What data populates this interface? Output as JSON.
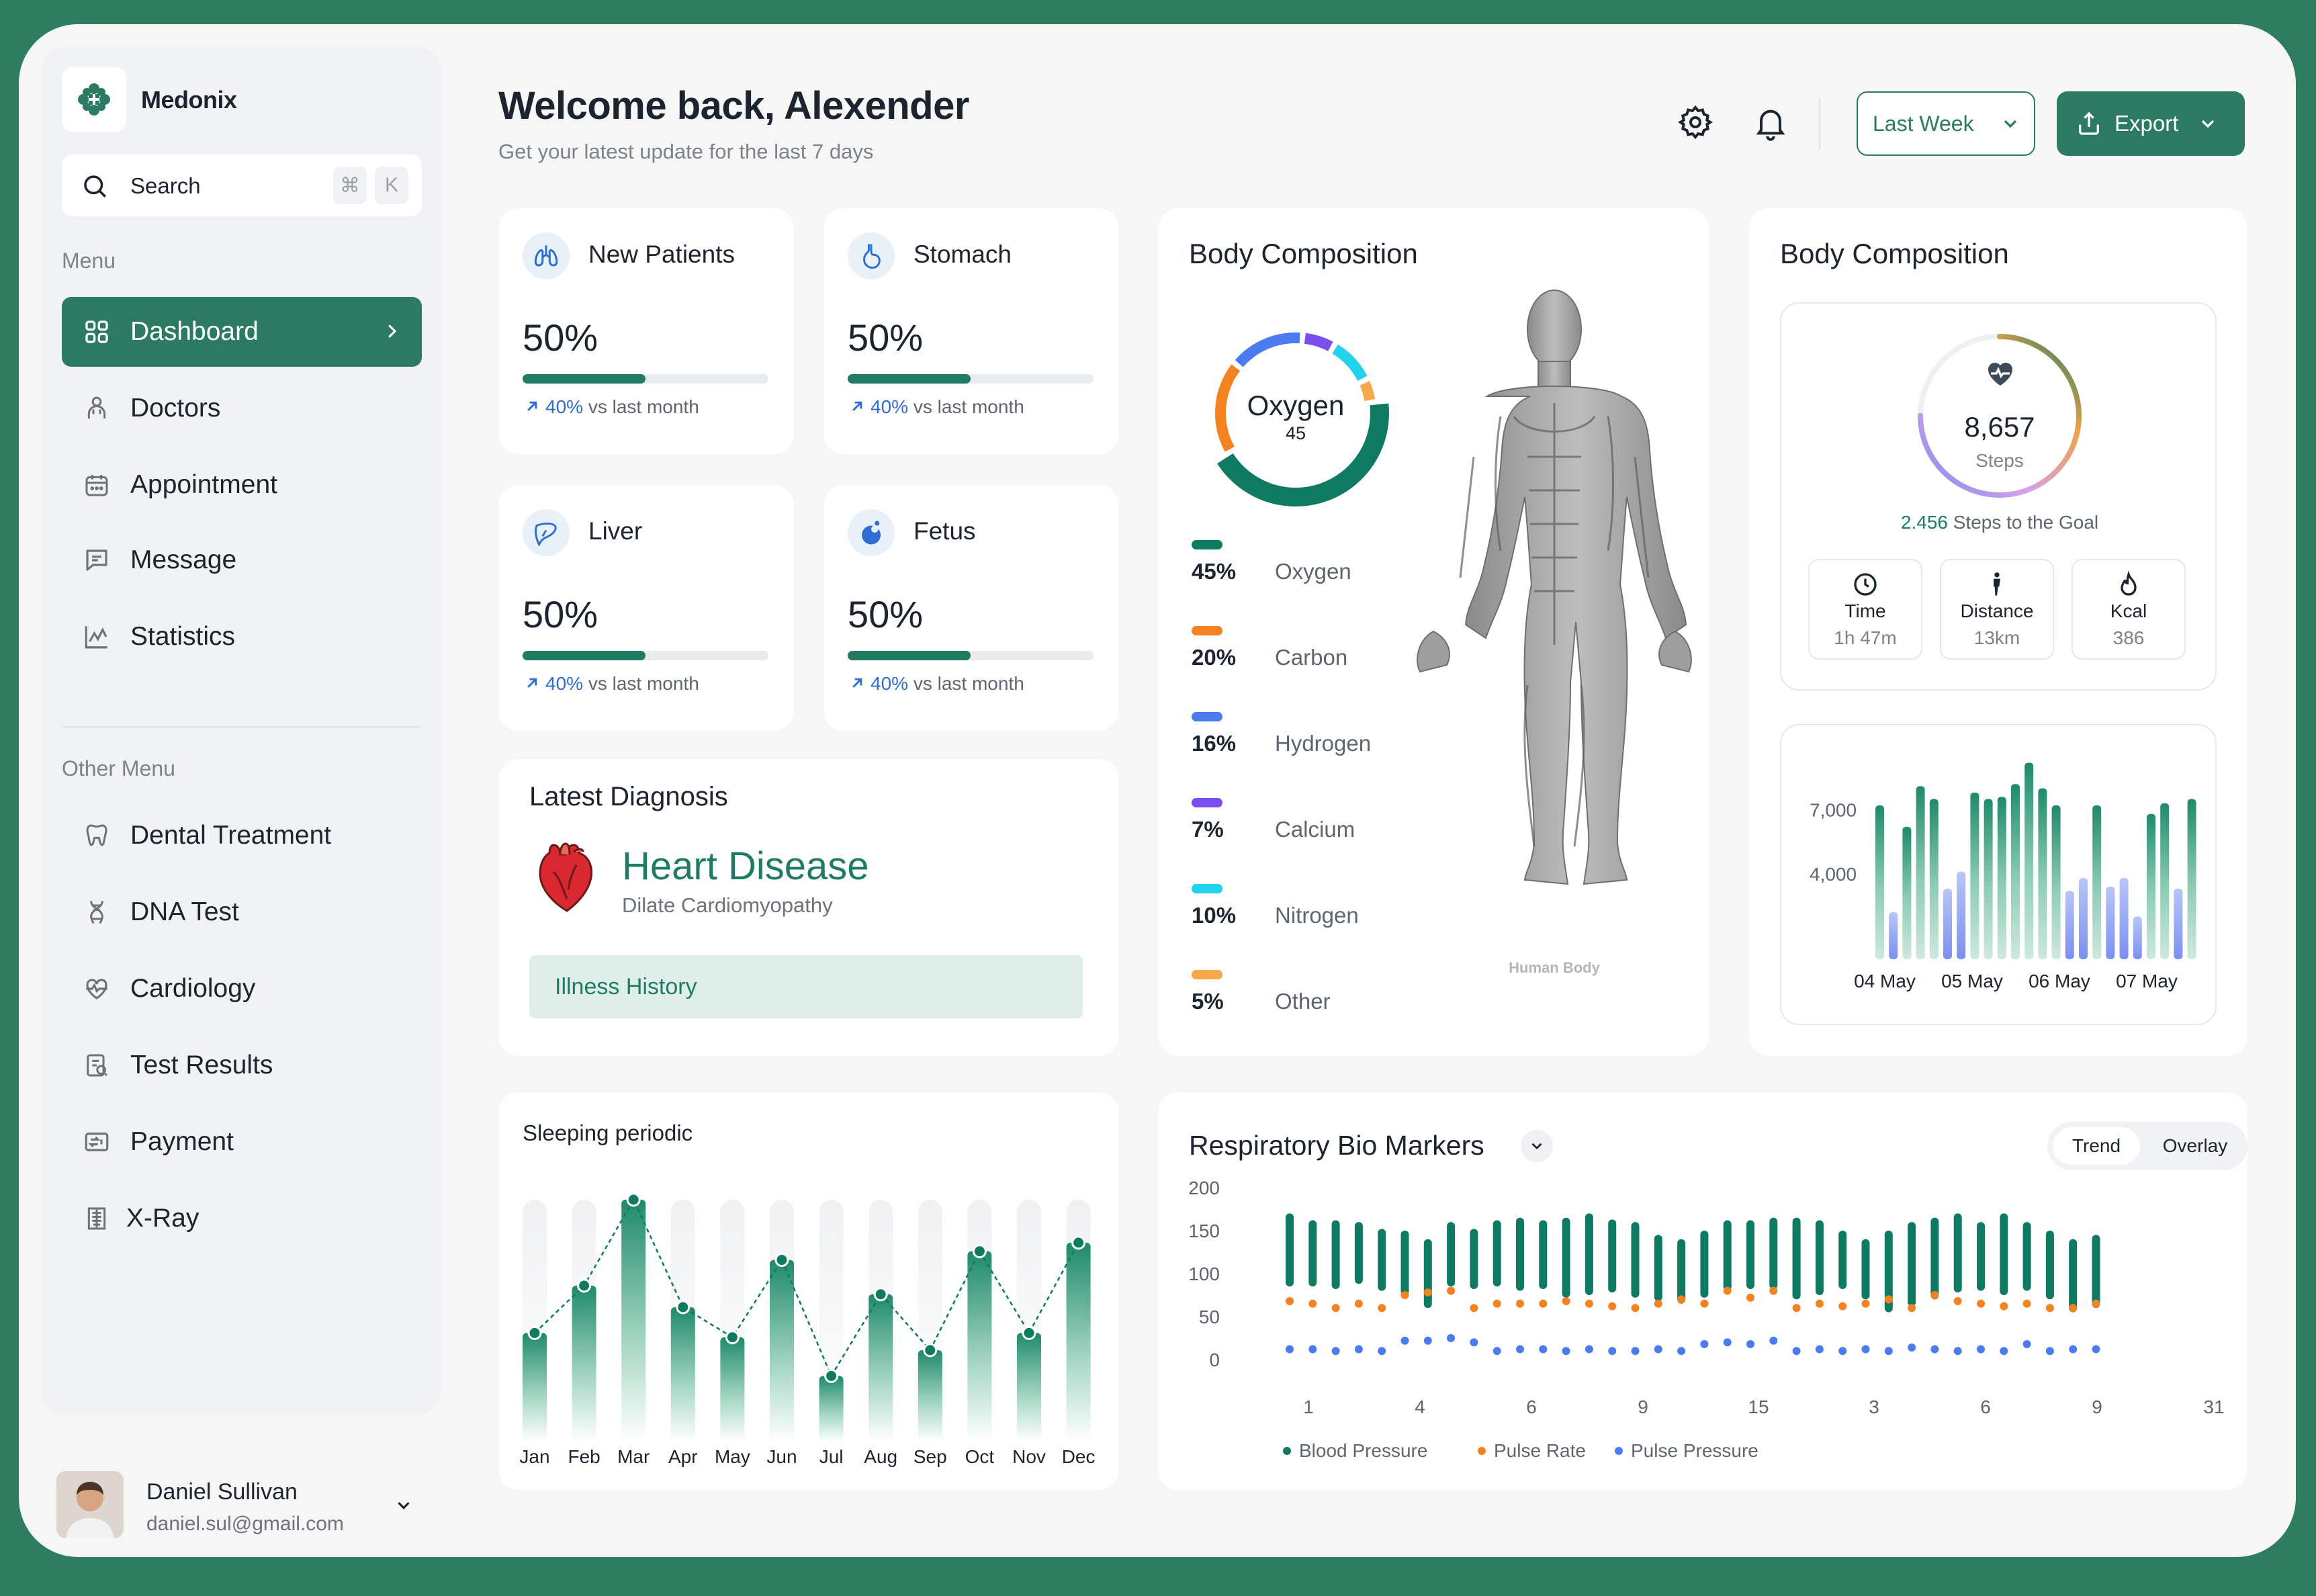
{
  "app": {
    "name": "Medonix"
  },
  "search": {
    "label": "Search",
    "shortcut_cmd": "⌘",
    "shortcut_key": "K"
  },
  "sidebar": {
    "menu_title": "Menu",
    "items": [
      {
        "label": "Dashboard",
        "icon": "grid-icon",
        "active": true
      },
      {
        "label": "Doctors",
        "icon": "doctor-icon"
      },
      {
        "label": "Appointment",
        "icon": "calendar-icon"
      },
      {
        "label": "Message",
        "icon": "message-icon"
      },
      {
        "label": "Statistics",
        "icon": "chart-line-icon"
      }
    ],
    "other_title": "Other Menu",
    "other_items": [
      {
        "label": "Dental Treatment",
        "icon": "tooth-icon"
      },
      {
        "label": "DNA Test",
        "icon": "dna-icon"
      },
      {
        "label": "Cardiology",
        "icon": "heart-pulse-icon"
      },
      {
        "label": "Test Results",
        "icon": "clipboard-icon"
      },
      {
        "label": "Payment",
        "icon": "payment-icon"
      },
      {
        "label": "X-Ray",
        "icon": "xray-icon"
      }
    ]
  },
  "user": {
    "name": "Daniel Sullivan",
    "email": "daniel.sul@gmail.com"
  },
  "header": {
    "title": "Welcome back, Alexender",
    "subtitle": "Get your latest update for the last 7 days",
    "period": "Last Week",
    "export": "Export"
  },
  "stats": [
    {
      "title": "New Patients",
      "value": "50%",
      "progress": 0.5,
      "change": "40%",
      "change_text": "vs last month",
      "icon": "lungs-icon"
    },
    {
      "title": "Stomach",
      "value": "50%",
      "progress": 0.5,
      "change": "40%",
      "change_text": "vs last month",
      "icon": "stomach-icon"
    },
    {
      "title": "Liver",
      "value": "50%",
      "progress": 0.5,
      "change": "40%",
      "change_text": "vs last month",
      "icon": "liver-icon"
    },
    {
      "title": "Fetus",
      "value": "50%",
      "progress": 0.5,
      "change": "40%",
      "change_text": "vs last month",
      "icon": "fetus-icon"
    }
  ],
  "diagnosis": {
    "title": "Latest Diagnosis",
    "name": "Heart Disease",
    "detail": "Dilate Cardiomyopathy",
    "button": "Illness History"
  },
  "body_composition": {
    "title": "Body Composition",
    "center_label": "Oxygen",
    "center_value": "45",
    "figure_caption": "Human Body",
    "items": [
      {
        "pct": "45%",
        "name": "Oxygen",
        "value": 45,
        "color": "#0f7a62"
      },
      {
        "pct": "20%",
        "name": "Carbon",
        "value": 20,
        "color": "#f58220"
      },
      {
        "pct": "16%",
        "name": "Hydrogen",
        "value": 16,
        "color": "#4a7cf0"
      },
      {
        "pct": "7%",
        "name": "Calcium",
        "value": 7,
        "color": "#7b4ef0"
      },
      {
        "pct": "10%",
        "name": "Nitrogen",
        "value": 10,
        "color": "#22d3ee"
      },
      {
        "pct": "5%",
        "name": "Other",
        "value": 5,
        "color": "#f7a84a"
      }
    ]
  },
  "steps": {
    "title": "Body Composition",
    "steps_value": "8,657",
    "steps_label": "Steps",
    "goal_value": "2.456",
    "goal_text": "Steps to the Goal",
    "progress": 0.75,
    "metrics": [
      {
        "label": "Time",
        "value": "1h 47m",
        "icon": "clock-icon"
      },
      {
        "label": "Distance",
        "value": "13km",
        "icon": "walking-icon"
      },
      {
        "label": "Kcal",
        "value": "386",
        "icon": "flame-icon"
      }
    ]
  },
  "chart_data": [
    {
      "type": "bar",
      "title": "",
      "ylim": [
        0,
        10000
      ],
      "yticks": [
        "7,000",
        "4,000"
      ],
      "ytick_values": [
        7000,
        4000
      ],
      "xticks": [
        "04 May",
        "05 May",
        "06 May",
        "07 May"
      ],
      "values": [
        7200,
        2200,
        6200,
        8100,
        7500,
        3300,
        4100,
        7800,
        7500,
        7600,
        8200,
        9200,
        8000,
        7200,
        3200,
        3800,
        7200,
        3400,
        3800,
        2000,
        6800,
        7300,
        3300,
        7500
      ]
    },
    {
      "type": "area",
      "title": "Sleeping periodic",
      "categories": [
        "Jan",
        "Feb",
        "Mar",
        "Apr",
        "May",
        "Jun",
        "Jul",
        "Aug",
        "Sep",
        "Oct",
        "Nov",
        "Dec"
      ],
      "values": [
        38,
        60,
        100,
        50,
        36,
        72,
        18,
        56,
        30,
        76,
        38,
        80
      ],
      "ylim": [
        0,
        100
      ]
    },
    {
      "type": "bar",
      "title": "Respiratory Bio Markers",
      "ylim": [
        0,
        200
      ],
      "yticks": [
        "200",
        "150",
        "100",
        "50",
        "0"
      ],
      "xticks": [
        "1",
        "4",
        "6",
        "9",
        "15",
        "3",
        "6",
        "9",
        "31"
      ],
      "view_modes": [
        "Trend",
        "Overlay"
      ],
      "series": [
        {
          "name": "Blood Pressure",
          "color": "#0f7a62",
          "high": [
            170,
            162,
            162,
            160,
            152,
            150,
            140,
            160,
            152,
            162,
            165,
            162,
            165,
            170,
            163,
            160,
            145,
            140,
            150,
            162,
            162,
            165,
            165,
            162,
            150,
            140,
            150,
            160,
            165,
            170,
            160,
            170,
            160,
            150,
            140,
            145
          ],
          "low": [
            85,
            85,
            82,
            88,
            80,
            75,
            60,
            85,
            82,
            85,
            80,
            82,
            72,
            75,
            78,
            72,
            68,
            65,
            72,
            80,
            82,
            82,
            70,
            75,
            82,
            70,
            55,
            62,
            70,
            78,
            80,
            75,
            80,
            70,
            55,
            60
          ]
        },
        {
          "name": "Pulse Rate",
          "color": "#f58220",
          "values": [
            68,
            65,
            60,
            65,
            60,
            75,
            78,
            80,
            60,
            65,
            65,
            65,
            68,
            65,
            62,
            60,
            65,
            70,
            65,
            80,
            72,
            80,
            60,
            65,
            62,
            65,
            70,
            60,
            75,
            68,
            65,
            62,
            65,
            60,
            60,
            65
          ]
        },
        {
          "name": "Pulse Pressure",
          "color": "#4a7cf0",
          "values": [
            12,
            12,
            10,
            12,
            10,
            22,
            22,
            25,
            20,
            10,
            12,
            12,
            10,
            12,
            10,
            10,
            12,
            10,
            18,
            20,
            18,
            22,
            10,
            12,
            10,
            12,
            10,
            14,
            12,
            10,
            12,
            10,
            18,
            10,
            12,
            12
          ]
        }
      ]
    }
  ]
}
